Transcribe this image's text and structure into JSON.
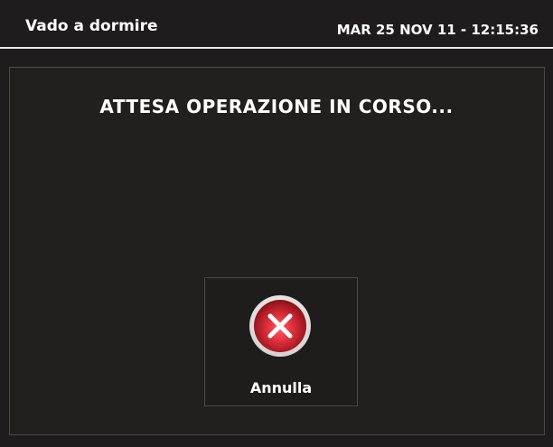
{
  "header": {
    "title": "Vado a dormire",
    "datetime": "MAR 25 NOV 11 - 12:15:36"
  },
  "main": {
    "message": "ATTESA OPERAZIONE IN CORSO..."
  },
  "cancel_button": {
    "label": "Annulla",
    "icon": "close-icon"
  },
  "colors": {
    "background": "#1e1c1c",
    "header_rule": "#e8e8e8",
    "panel_border": "#4c4949",
    "icon_red": "#e0303c",
    "icon_ring": "#f2ecec"
  }
}
